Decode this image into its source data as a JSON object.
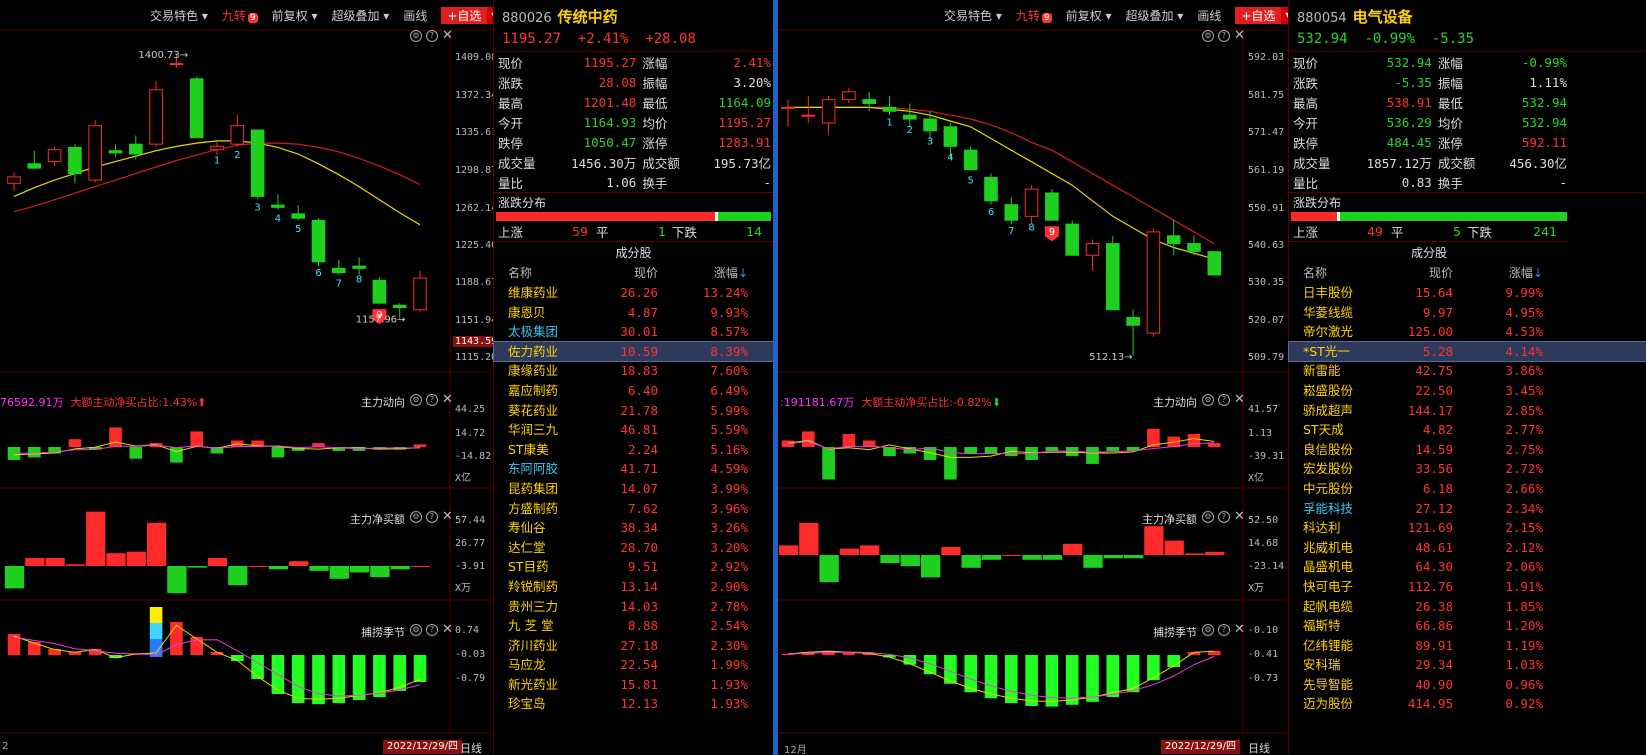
{
  "toolbar": {
    "trade_features": "交易特色",
    "jiuzhuan": "九转",
    "jiuzhuan_badge": "9",
    "restore": "前复权",
    "super_overlay": "超级叠加",
    "draw_line": "画线",
    "add_watchlist": "+自选"
  },
  "panels": {
    "main_flow": "主力动向",
    "main_net_buy": "主力净买额",
    "season": "捕捞季节"
  },
  "left": {
    "code": "880026",
    "name": "传统中药",
    "price": "1195.27",
    "pct": "+2.41%",
    "chg": "+28.08",
    "quote": [
      {
        "l1": "现价",
        "v1": "1195.27",
        "c1": "red",
        "l2": "涨幅",
        "v2": "2.41%",
        "c2": "red"
      },
      {
        "l1": "涨跌",
        "v1": "28.08",
        "c1": "red",
        "l2": "振幅",
        "v2": "3.20%",
        "c2": "wht"
      },
      {
        "l1": "最高",
        "v1": "1201.48",
        "c1": "red",
        "l2": "最低",
        "v2": "1164.09",
        "c2": "grn"
      },
      {
        "l1": "今开",
        "v1": "1164.93",
        "c1": "grn",
        "l2": "均价",
        "v2": "1195.27",
        "c2": "red"
      },
      {
        "l1": "跌停",
        "v1": "1050.47",
        "c1": "grn",
        "l2": "涨停",
        "v2": "1283.91",
        "c2": "red"
      },
      {
        "l1": "成交量",
        "v1": "1456.30万",
        "c1": "wht",
        "l2": "成交额",
        "v2": "195.73亿",
        "c2": "wht"
      },
      {
        "l1": "量比",
        "v1": "1.06",
        "c1": "wht",
        "l2": "换手",
        "v2": "-",
        "c2": "wht"
      }
    ],
    "dist_title": "涨跌分布",
    "up_lbl": "上涨",
    "up": "59",
    "flat_lbl": "平",
    "flat": "1",
    "down_lbl": "下跌",
    "down": "14",
    "up_frac": 0.7973,
    "comp_title": "成分股",
    "col_name": "名称",
    "col_price": "现价",
    "col_chg": "涨幅",
    "rows": [
      {
        "n": "维康药业",
        "p": "26.26",
        "c": "13.24%",
        "nc": "yel"
      },
      {
        "n": "康恩贝",
        "p": "4.87",
        "c": "9.93%",
        "nc": "yel"
      },
      {
        "n": "太极集团",
        "p": "30.01",
        "c": "8.57%",
        "nc": "cyan"
      },
      {
        "n": "佐力药业",
        "p": "10.59",
        "c": "8.39%",
        "nc": "yel"
      },
      {
        "n": "康缘药业",
        "p": "18.83",
        "c": "7.60%",
        "nc": "yel"
      },
      {
        "n": "嘉应制药",
        "p": "6.40",
        "c": "6.49%",
        "nc": "yel"
      },
      {
        "n": "葵花药业",
        "p": "21.78",
        "c": "5.99%",
        "nc": "yel"
      },
      {
        "n": "华润三九",
        "p": "46.81",
        "c": "5.59%",
        "nc": "yel"
      },
      {
        "n": "ST康美",
        "p": "2.24",
        "c": "5.16%",
        "nc": "yel"
      },
      {
        "n": "东阿阿胶",
        "p": "41.71",
        "c": "4.59%",
        "nc": "cyan"
      },
      {
        "n": "昆药集团",
        "p": "14.07",
        "c": "3.99%",
        "nc": "yel"
      },
      {
        "n": "方盛制药",
        "p": "7.62",
        "c": "3.96%",
        "nc": "yel"
      },
      {
        "n": "寿仙谷",
        "p": "38.34",
        "c": "3.26%",
        "nc": "yel"
      },
      {
        "n": "达仁堂",
        "p": "28.70",
        "c": "3.20%",
        "nc": "yel"
      },
      {
        "n": "ST目药",
        "p": "9.51",
        "c": "2.92%",
        "nc": "yel"
      },
      {
        "n": "羚锐制药",
        "p": "13.14",
        "c": "2.90%",
        "nc": "yel"
      },
      {
        "n": "贵州三力",
        "p": "14.03",
        "c": "2.78%",
        "nc": "yel"
      },
      {
        "n": "九 芝 堂",
        "p": "8.88",
        "c": "2.54%",
        "nc": "yel"
      },
      {
        "n": "济川药业",
        "p": "27.18",
        "c": "2.30%",
        "nc": "yel"
      },
      {
        "n": "马应龙",
        "p": "22.54",
        "c": "1.99%",
        "nc": "yel"
      },
      {
        "n": "新光药业",
        "p": "15.81",
        "c": "1.93%",
        "nc": "yel"
      },
      {
        "n": "珍宝岛",
        "p": "12.13",
        "c": "1.93%",
        "nc": "yel"
      }
    ],
    "axis_main": [
      "1409.08",
      "1372.34",
      "1335.61",
      "1298.87",
      "1262.14",
      "1225.40",
      "1188.67",
      "1151.94",
      "1115.20"
    ],
    "axis_cur": "1143.59",
    "hi_label": "1400.73",
    "lo_label": "1157.96",
    "axis_flow": [
      "44.25",
      "14.72",
      "-14.82",
      "X亿"
    ],
    "axis_net": [
      "57.44",
      "26.77",
      "-3.91",
      "X万"
    ],
    "axis_season": [
      "0.74",
      "-0.03",
      "-0.79"
    ],
    "flow_stats": "76592.91万",
    "flow_ratio": "大额主动净买占比:1.43%",
    "date": "2022/12/29/四",
    "period": "日线",
    "month": "2"
  },
  "right": {
    "code": "880054",
    "name": "电气设备",
    "price": "532.94",
    "pct": "-0.99%",
    "chg": "-5.35",
    "quote": [
      {
        "l1": "现价",
        "v1": "532.94",
        "c1": "grn",
        "l2": "涨幅",
        "v2": "-0.99%",
        "c2": "grn"
      },
      {
        "l1": "涨跌",
        "v1": "-5.35",
        "c1": "grn",
        "l2": "振幅",
        "v2": "1.11%",
        "c2": "wht"
      },
      {
        "l1": "最高",
        "v1": "538.91",
        "c1": "red",
        "l2": "最低",
        "v2": "532.94",
        "c2": "grn"
      },
      {
        "l1": "今开",
        "v1": "536.29",
        "c1": "grn",
        "l2": "均价",
        "v2": "532.94",
        "c2": "grn"
      },
      {
        "l1": "跌停",
        "v1": "484.45",
        "c1": "grn",
        "l2": "涨停",
        "v2": "592.11",
        "c2": "red"
      },
      {
        "l1": "成交量",
        "v1": "1857.12万",
        "c1": "wht",
        "l2": "成交额",
        "v2": "456.30亿",
        "c2": "wht"
      },
      {
        "l1": "量比",
        "v1": "0.83",
        "c1": "wht",
        "l2": "换手",
        "v2": "-",
        "c2": "wht"
      }
    ],
    "dist_title": "涨跌分布",
    "up_lbl": "上涨",
    "up": "49",
    "flat_lbl": "平",
    "flat": "5",
    "down_lbl": "下跌",
    "down": "241",
    "up_frac": 0.1661,
    "comp_title": "成分股",
    "col_name": "名称",
    "col_price": "现价",
    "col_chg": "涨幅",
    "rows": [
      {
        "n": "日丰股份",
        "p": "15.64",
        "c": "9.99%",
        "nc": "yel"
      },
      {
        "n": "华菱线缆",
        "p": "9.97",
        "c": "4.95%",
        "nc": "yel"
      },
      {
        "n": "帝尔激光",
        "p": "125.00",
        "c": "4.53%",
        "nc": "yel"
      },
      {
        "n": "*ST光一",
        "p": "5.28",
        "c": "4.14%",
        "nc": "yel"
      },
      {
        "n": "新雷能",
        "p": "42.75",
        "c": "3.86%",
        "nc": "yel"
      },
      {
        "n": "崧盛股份",
        "p": "22.50",
        "c": "3.45%",
        "nc": "yel"
      },
      {
        "n": "骄成超声",
        "p": "144.17",
        "c": "2.85%",
        "nc": "yel"
      },
      {
        "n": "ST天成",
        "p": "4.82",
        "c": "2.77%",
        "nc": "yel"
      },
      {
        "n": "良信股份",
        "p": "14.59",
        "c": "2.75%",
        "nc": "yel"
      },
      {
        "n": "宏发股份",
        "p": "33.56",
        "c": "2.72%",
        "nc": "yel"
      },
      {
        "n": "中元股份",
        "p": "6.18",
        "c": "2.66%",
        "nc": "yel"
      },
      {
        "n": "孚能科技",
        "p": "27.12",
        "c": "2.34%",
        "nc": "cyan"
      },
      {
        "n": "科达利",
        "p": "121.69",
        "c": "2.15%",
        "nc": "yel"
      },
      {
        "n": "兆威机电",
        "p": "48.61",
        "c": "2.12%",
        "nc": "yel"
      },
      {
        "n": "晶盛机电",
        "p": "64.30",
        "c": "2.06%",
        "nc": "yel"
      },
      {
        "n": "快可电子",
        "p": "112.76",
        "c": "1.91%",
        "nc": "yel"
      },
      {
        "n": "起帆电缆",
        "p": "26.38",
        "c": "1.85%",
        "nc": "yel"
      },
      {
        "n": "福斯特",
        "p": "66.86",
        "c": "1.20%",
        "nc": "yel"
      },
      {
        "n": "亿纬锂能",
        "p": "89.91",
        "c": "1.19%",
        "nc": "yel"
      },
      {
        "n": "安科瑞",
        "p": "29.34",
        "c": "1.03%",
        "nc": "yel"
      },
      {
        "n": "先导智能",
        "p": "40.90",
        "c": "0.96%",
        "nc": "yel"
      },
      {
        "n": "迈为股份",
        "p": "414.95",
        "c": "0.92%",
        "nc": "yel"
      }
    ],
    "axis_main": [
      "592.03",
      "581.75",
      "571.47",
      "561.19",
      "550.91",
      "540.63",
      "530.35",
      "520.07",
      "509.79"
    ],
    "lo_label": "512.13",
    "axis_flow": [
      "41.57",
      "1.13",
      "-39.31",
      "X亿"
    ],
    "axis_net": [
      "52.50",
      "14.68",
      "-23.14",
      "X万"
    ],
    "axis_season": [
      "-0.10",
      "-0.41",
      "-0.73"
    ],
    "flow_stats": ":191181.67万",
    "flow_ratio": "大额主动净买占比:-0.82%",
    "date": "2022/12/29/四",
    "period": "日线",
    "month": "12月"
  },
  "colors": {
    "up": "#ff2a2a",
    "down": "#1fd01f",
    "bg": "#000000",
    "accent_sep": "#1e62c8",
    "name_yellow": "#ffd200"
  },
  "chart_data": [
    {
      "type": "candlestick",
      "series_name": "880026 传统中药",
      "ylim": [
        1115.2,
        1409.08
      ],
      "ohlc": [
        [
          1282,
          1292,
          1275,
          1288
        ],
        [
          1300,
          1312,
          1295,
          1296
        ],
        [
          1302,
          1316,
          1298,
          1313
        ],
        [
          1315,
          1318,
          1282,
          1291
        ],
        [
          1285,
          1340,
          1283,
          1335
        ],
        [
          1312,
          1318,
          1306,
          1310
        ],
        [
          1318,
          1326,
          1304,
          1309
        ],
        [
          1318,
          1376,
          1316,
          1368
        ],
        [
          1392,
          1400.73,
          1388,
          1392
        ],
        [
          1378,
          1380,
          1325,
          1324
        ],
        [
          1313,
          1320,
          1308,
          1316
        ],
        [
          1318,
          1345,
          1316,
          1335
        ],
        [
          1331,
          1331,
          1268,
          1270
        ],
        [
          1262,
          1272,
          1258,
          1260
        ],
        [
          1254,
          1262,
          1248,
          1250
        ],
        [
          1248,
          1250,
          1206,
          1210
        ],
        [
          1204,
          1212,
          1198,
          1200
        ],
        [
          1206,
          1214,
          1198,
          1204
        ],
        [
          1193,
          1196,
          1172,
          1172
        ],
        [
          1170,
          1172,
          1157.96,
          1168
        ],
        [
          1166,
          1201.48,
          1164,
          1195
        ]
      ],
      "td_labels": [
        {
          "i": 10,
          "t": "1"
        },
        {
          "i": 11,
          "t": "2"
        },
        {
          "i": 12,
          "t": "3"
        },
        {
          "i": 13,
          "t": "4"
        },
        {
          "i": 14,
          "t": "5"
        },
        {
          "i": 15,
          "t": "6"
        },
        {
          "i": 16,
          "t": "7"
        },
        {
          "i": 17,
          "t": "8"
        },
        {
          "i": 18,
          "t": "9"
        }
      ],
      "ma_yellow": [
        1270,
        1278,
        1285,
        1291,
        1297,
        1302,
        1307,
        1312,
        1316,
        1319,
        1321,
        1321,
        1319,
        1315,
        1309,
        1300,
        1290,
        1279,
        1267,
        1255,
        1244
      ],
      "ma_red": [
        1256,
        1261,
        1267,
        1273,
        1279,
        1285,
        1291,
        1297,
        1303,
        1308,
        1313,
        1317,
        1319,
        1319,
        1318,
        1315,
        1311,
        1305,
        1298,
        1290,
        1281
      ],
      "flow": [
        -10,
        -8,
        -5,
        6,
        -2,
        15,
        -9,
        3,
        -12,
        12,
        -5,
        5,
        5,
        -8,
        -3,
        3,
        -3,
        -3,
        -2,
        -2,
        2
      ],
      "net": [
        -14,
        5,
        5,
        1,
        34,
        8,
        9,
        27,
        -17,
        -1,
        5,
        -12,
        0,
        -2,
        3,
        -3,
        -8,
        -4,
        -7,
        -2,
        0
      ],
      "season": [
        0.35,
        0.22,
        0.1,
        0.05,
        0.1,
        -0.05,
        0.02,
        0.04,
        0.55,
        0.3,
        0.05,
        -0.1,
        -0.4,
        -0.65,
        -0.8,
        -0.82,
        -0.8,
        -0.75,
        -0.7,
        -0.6,
        -0.45
      ]
    },
    {
      "type": "candlestick",
      "series_name": "880054 电气设备",
      "ylim": [
        509.79,
        592.03
      ],
      "ohlc": [
        [
          576,
          578,
          571,
          576
        ],
        [
          574,
          579,
          572,
          574
        ],
        [
          572,
          579,
          569,
          578
        ],
        [
          578,
          581,
          577,
          580
        ],
        [
          578,
          580,
          575,
          577
        ],
        [
          576,
          579,
          574,
          575
        ],
        [
          574,
          577,
          571,
          573
        ],
        [
          573,
          575,
          568,
          570
        ],
        [
          571,
          572,
          563,
          566
        ],
        [
          565,
          566,
          560,
          560
        ],
        [
          558,
          559,
          551,
          552
        ],
        [
          551,
          553,
          546,
          547
        ],
        [
          548,
          556,
          546,
          555
        ],
        [
          554,
          555,
          547,
          547
        ],
        [
          546,
          547,
          538,
          538
        ],
        [
          538,
          542,
          534,
          541
        ],
        [
          541,
          543,
          524,
          524
        ],
        [
          522,
          524,
          512.13,
          520
        ],
        [
          518,
          545,
          517,
          544
        ],
        [
          543,
          547,
          538,
          541
        ],
        [
          541,
          543,
          538,
          539
        ],
        [
          538.91,
          538.91,
          532.94,
          532.94
        ]
      ],
      "td_labels": [
        {
          "i": 5,
          "t": "1"
        },
        {
          "i": 6,
          "t": "2"
        },
        {
          "i": 7,
          "t": "3"
        },
        {
          "i": 8,
          "t": "4"
        },
        {
          "i": 9,
          "t": "5"
        },
        {
          "i": 10,
          "t": "6"
        },
        {
          "i": 11,
          "t": "7"
        },
        {
          "i": 12,
          "t": "8"
        },
        {
          "i": 13,
          "t": "9"
        }
      ],
      "ma_yellow": [
        576,
        576,
        576,
        576,
        576,
        575.5,
        575,
        574,
        572.5,
        571,
        568,
        565,
        562,
        559,
        556,
        552,
        548,
        545,
        542,
        540,
        538.5,
        537
      ],
      "ma_red": [
        576,
        576,
        576,
        576,
        576,
        576,
        575.5,
        575,
        574,
        573,
        571.5,
        569.5,
        567,
        565,
        562,
        559,
        556,
        553,
        550,
        547,
        544,
        541
      ],
      "flow": [
        5,
        12,
        -25,
        10,
        5,
        -7,
        -5,
        -10,
        -25,
        -5,
        -5,
        -7,
        -10,
        -3,
        -7,
        -13,
        -3,
        -3,
        14,
        8,
        10,
        3
      ],
      "net": [
        6,
        20,
        -17,
        4,
        6,
        -5,
        -7,
        -14,
        5,
        -8,
        -3,
        0,
        -3,
        -3,
        7,
        -8,
        -2,
        -2,
        18,
        9,
        1,
        2
      ],
      "season": [
        0.02,
        0.05,
        0.07,
        0.05,
        0.03,
        -0.04,
        -0.16,
        -0.32,
        -0.48,
        -0.62,
        -0.72,
        -0.8,
        -0.85,
        -0.86,
        -0.83,
        -0.78,
        -0.7,
        -0.62,
        -0.42,
        -0.2,
        0.05,
        0.07
      ]
    }
  ]
}
